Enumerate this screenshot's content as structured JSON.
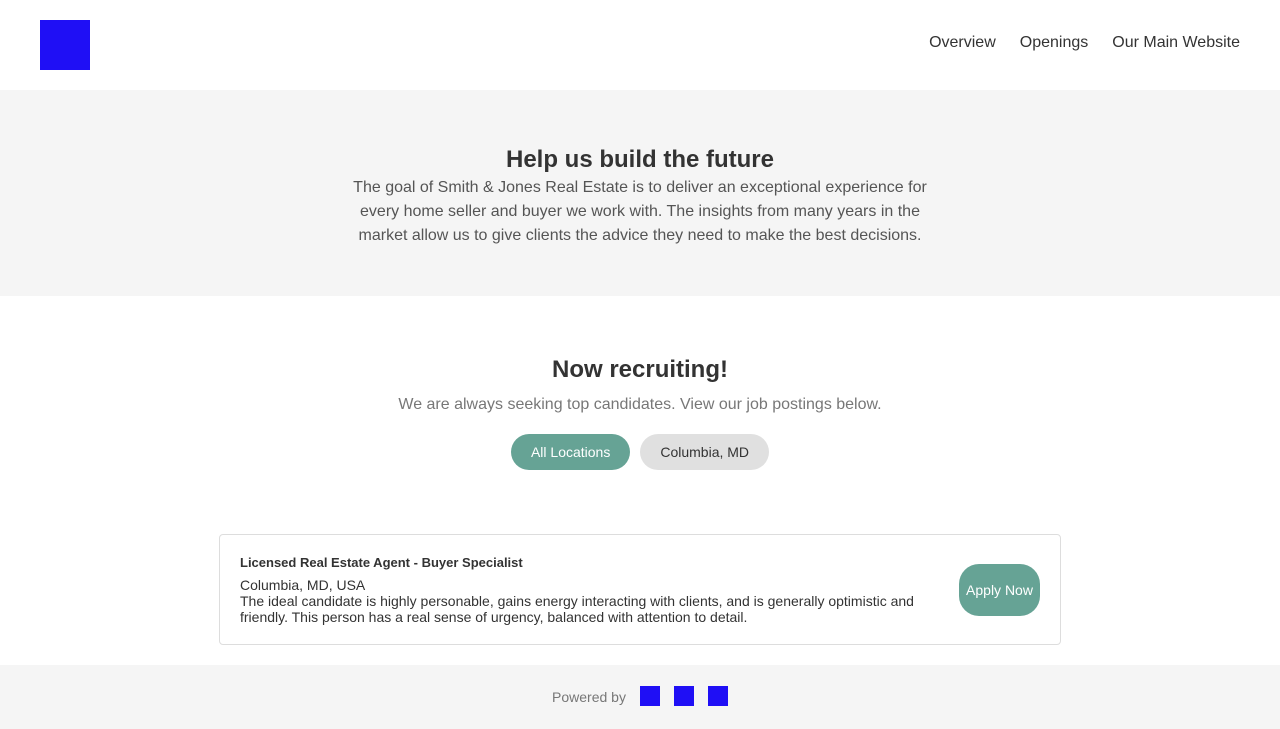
{
  "nav": {
    "items": [
      "Overview",
      "Openings",
      "Our Main Website"
    ]
  },
  "hero": {
    "title": "Help us build the future",
    "text": "The goal of Smith & Jones Real Estate is to deliver an exceptional experience for every home seller and buyer we work with. The insights from many years in the market allow us to give clients the advice they need to make the best decisions."
  },
  "recruit": {
    "title": "Now recruiting!",
    "subtitle": "We are always seeking top candidates. View our job postings below.",
    "filters": [
      "All Locations",
      "Columbia, MD"
    ]
  },
  "job": {
    "title": "Licensed Real Estate Agent - Buyer Specialist",
    "location": "Columbia, MD, USA",
    "description": "The ideal candidate is highly personable, gains energy interacting with clients, and is generally optimistic and friendly. This person has a real sense of urgency, balanced with attention to detail.",
    "apply": "Apply Now"
  },
  "footer": {
    "powered_by": "Powered by"
  },
  "colors": {
    "accent": "#66a395",
    "logo": "#1f0ff5"
  }
}
